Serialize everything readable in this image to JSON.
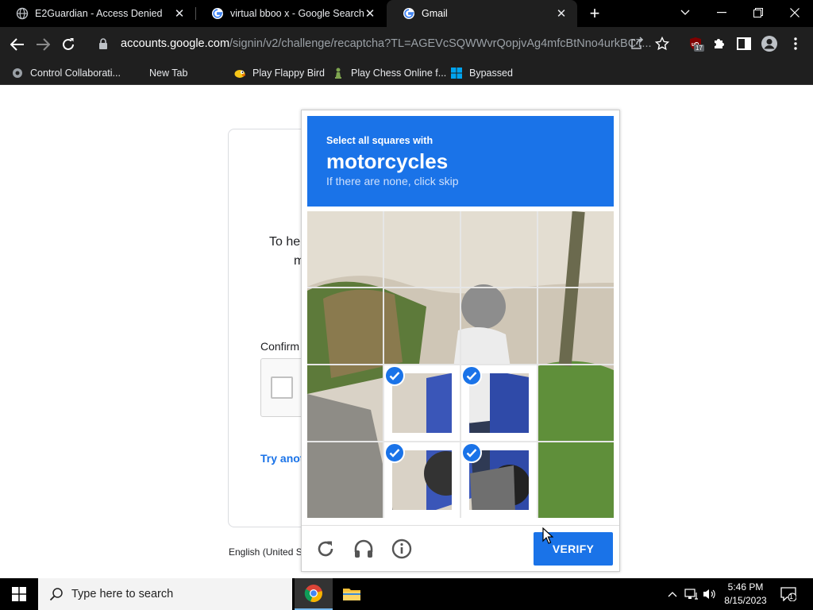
{
  "browser": {
    "tabs": [
      {
        "title": "E2Guardian - Access Denied",
        "active": false
      },
      {
        "title": "virtual bboo x - Google Search",
        "active": false
      },
      {
        "title": "Gmail",
        "active": true
      }
    ],
    "url_host": "accounts.google.com",
    "url_path": "/signin/v2/challenge/recaptcha?TL=AGEVcSQWWvrQopjvAg4mfcBtNno4urkBCT...",
    "extension_badge": "17",
    "bookmarks": [
      {
        "label": "Control Collaborati..."
      },
      {
        "label": "New Tab"
      },
      {
        "label": "Play Flappy Bird"
      },
      {
        "label": "Play Chess Online f..."
      },
      {
        "label": "Bypassed"
      }
    ]
  },
  "signin": {
    "help_line1": "To he",
    "help_line2": "m",
    "confirm_label": "Confirm",
    "try_another": "Try anot",
    "footer_lang": "English (United S"
  },
  "challenge": {
    "prompt_small": "Select all squares with",
    "prompt_target": "motorcycles",
    "prompt_sub": "If there are none, click skip",
    "verify_label": "VERIFY",
    "grid_size": 4,
    "selected_tiles": [
      9,
      10,
      13,
      14
    ],
    "accent_color": "#1a73e8"
  },
  "taskbar": {
    "search_placeholder": "Type here to search",
    "time": "5:46 PM",
    "date": "8/15/2023",
    "notification_count": "1"
  }
}
